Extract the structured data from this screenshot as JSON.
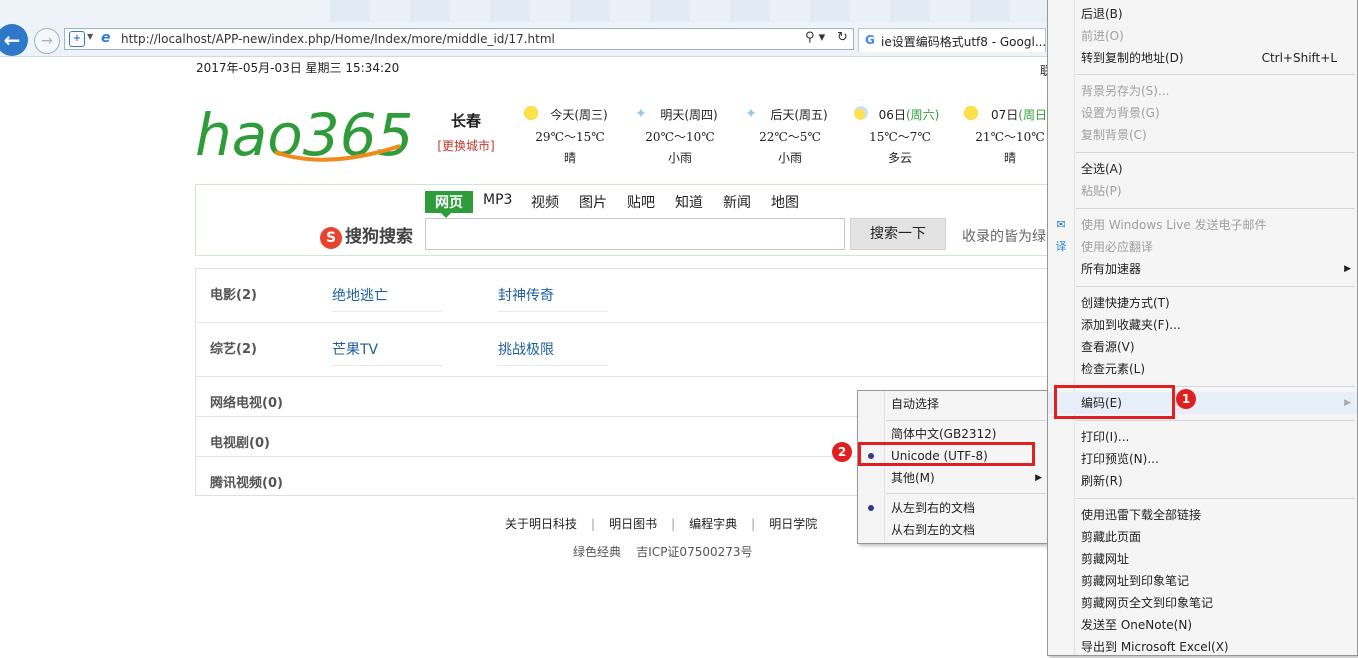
{
  "browser": {
    "url": "http://localhost/APP-new/index.php/Home/Index/more/middle_id/17.html",
    "tab_title": "ie设置编码格式utf8 - Googl...",
    "tab_favicon": "G"
  },
  "page": {
    "datetime": "2017年-05月-03日 星期三 15:34:20",
    "right_edge_char": "联",
    "logo": {
      "text": "hao365",
      "color": "#2f9c3a",
      "accent": "#f08a1c"
    },
    "city": {
      "name": "长春",
      "change_label": "[更换城市]"
    },
    "weather": [
      {
        "day": "今天(周三)",
        "day_main": "今天(周三)",
        "temp": "29℃～15℃",
        "cond": "晴",
        "icon": "sun-icon"
      },
      {
        "day": "明天(周四)",
        "day_main": "明天(周四)",
        "temp": "20℃～10℃",
        "cond": "小雨",
        "icon": "rain-icon"
      },
      {
        "day": "后天(周五)",
        "day_main": "后天(周五)",
        "temp": "22℃～5℃",
        "cond": "小雨",
        "icon": "rain-icon"
      },
      {
        "day": "06日(周六)",
        "day_main": "06日",
        "day_weekend": "(周六)",
        "temp": "15℃～7℃",
        "cond": "多云",
        "icon": "cloudy-icon"
      },
      {
        "day": "07日(周日",
        "day_main": "07日",
        "day_weekend": "(周日",
        "temp": "21℃～10℃",
        "cond": "晴",
        "icon": "sun-icon"
      }
    ],
    "search": {
      "tabs": [
        "网页",
        "MP3",
        "视频",
        "图片",
        "贴吧",
        "知道",
        "新闻",
        "地图"
      ],
      "engine": "搜狗搜索",
      "button": "搜索一下",
      "hint": "收录的皆为绿"
    },
    "categories": [
      {
        "label": "电影(2)",
        "links": [
          "绝地逃亡",
          "封神传奇"
        ]
      },
      {
        "label": "综艺(2)",
        "links": [
          "芒果TV",
          "挑战极限"
        ]
      },
      {
        "label": "网络电视(0)",
        "links": []
      },
      {
        "label": "电视剧(0)",
        "links": []
      },
      {
        "label": "腾讯视频(0)",
        "links": []
      }
    ],
    "footer": {
      "links": [
        "关于明日科技",
        "明日图书",
        "编程字典",
        "明日学院"
      ],
      "separator": "|",
      "bottom": [
        "绿色经典",
        "吉ICP证07500273号"
      ]
    }
  },
  "context_menu": {
    "items": [
      {
        "label": "后退(B)",
        "disabled": false
      },
      {
        "label": "前进(O)",
        "disabled": true
      },
      {
        "label": "转到复制的地址(D)",
        "shortcut": "Ctrl+Shift+L",
        "disabled": false
      },
      {
        "label": "背景另存为(S)...",
        "disabled": true
      },
      {
        "label": "设置为背景(G)",
        "disabled": true
      },
      {
        "label": "复制背景(C)",
        "disabled": true
      },
      {
        "label": "全选(A)",
        "disabled": false
      },
      {
        "label": "粘贴(P)",
        "disabled": true
      },
      {
        "label": "使用 Windows Live 发送电子邮件",
        "disabled": true
      },
      {
        "label": "使用必应翻译",
        "disabled": true
      },
      {
        "label": "所有加速器",
        "disabled": false
      },
      {
        "label": "创建快捷方式(T)",
        "disabled": false
      },
      {
        "label": "添加到收藏夹(F)...",
        "disabled": false
      },
      {
        "label": "查看源(V)",
        "disabled": false
      },
      {
        "label": "检查元素(L)",
        "disabled": false
      },
      {
        "label": "编码(E)",
        "disabled": false
      },
      {
        "label": "打印(I)...",
        "disabled": false
      },
      {
        "label": "打印预览(N)...",
        "disabled": false
      },
      {
        "label": "刷新(R)",
        "disabled": false
      },
      {
        "label": "使用迅雷下载全部链接",
        "disabled": false
      },
      {
        "label": "剪藏此页面",
        "disabled": false
      },
      {
        "label": "剪藏网址",
        "disabled": false
      },
      {
        "label": "剪藏网址到印象笔记",
        "disabled": false
      },
      {
        "label": "剪藏网页全文到印象笔记",
        "disabled": false
      },
      {
        "label": "发送至 OneNote(N)",
        "disabled": false
      },
      {
        "label": "导出到 Microsoft Excel(X)",
        "disabled": false
      }
    ]
  },
  "encoding_submenu": {
    "items": [
      {
        "label": "自动选择"
      },
      {
        "label": "简体中文(GB2312)"
      },
      {
        "label": "Unicode (UTF-8)",
        "checked": true
      },
      {
        "label": "其他(M)"
      },
      {
        "label": "从左到右的文档",
        "checked": true
      },
      {
        "label": "从右到左的文档"
      }
    ]
  },
  "annotations": {
    "badge_1": "1",
    "badge_2": "2",
    "color": "#e02020"
  }
}
